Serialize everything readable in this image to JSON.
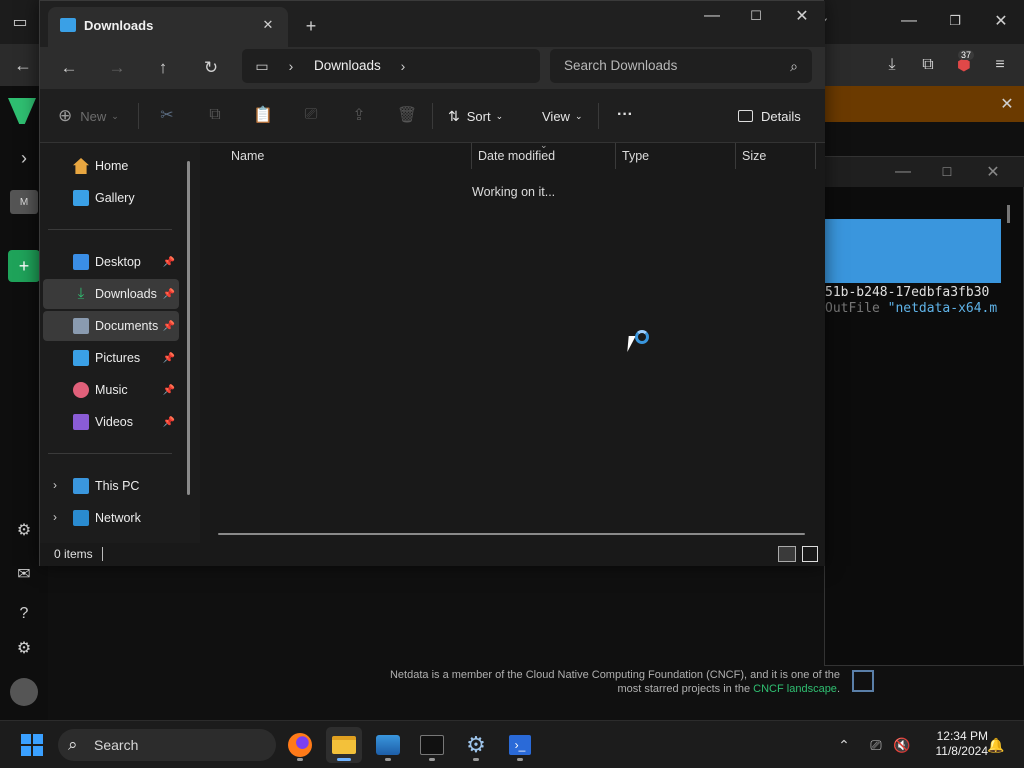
{
  "explorer": {
    "tab_title": "Downloads",
    "breadcrumb": [
      "Downloads"
    ],
    "search_placeholder": "Search Downloads",
    "commands": {
      "new": "New",
      "sort": "Sort",
      "view": "View",
      "details": "Details"
    },
    "nav": {
      "home": "Home",
      "gallery": "Gallery",
      "pinned": [
        {
          "label": "Desktop",
          "icon": "desktop-icon",
          "color": "#3a8ee6"
        },
        {
          "label": "Downloads",
          "icon": "download-icon",
          "color": "#2fbf71",
          "selected": true
        },
        {
          "label": "Documents",
          "icon": "document-icon",
          "color": "#8a9bb0",
          "selected": true
        },
        {
          "label": "Pictures",
          "icon": "pictures-icon",
          "color": "#3aa0e6"
        },
        {
          "label": "Music",
          "icon": "music-icon",
          "color": "#e0607a"
        },
        {
          "label": "Videos",
          "icon": "videos-icon",
          "color": "#8a5cd6"
        }
      ],
      "this_pc": "This PC",
      "network": "Network"
    },
    "columns": [
      "Name",
      "Date modified",
      "Type",
      "Size"
    ],
    "loading_text": "Working on it...",
    "status": "0 items"
  },
  "terminal": {
    "line1": "51b-b248-17edbfa3fb30",
    "line2_prefix": "OutFile ",
    "line2_string": "\"netdata-x64.m"
  },
  "browser": {
    "badge_count": "37"
  },
  "footer": {
    "line1": "Netdata is a member of the Cloud Native Computing Foundation (CNCF), and it is one of the",
    "line2_prefix": "most starred projects in the ",
    "line2_link": "CNCF landscape",
    "line2_suffix": "."
  },
  "taskbar": {
    "search_placeholder": "Search",
    "time": "12:34 PM",
    "date": "11/8/2024"
  },
  "colors": {
    "accent": "#3a8ee6",
    "netdata_green": "#2fbf71",
    "terminal_blue": "#3a96dd"
  }
}
